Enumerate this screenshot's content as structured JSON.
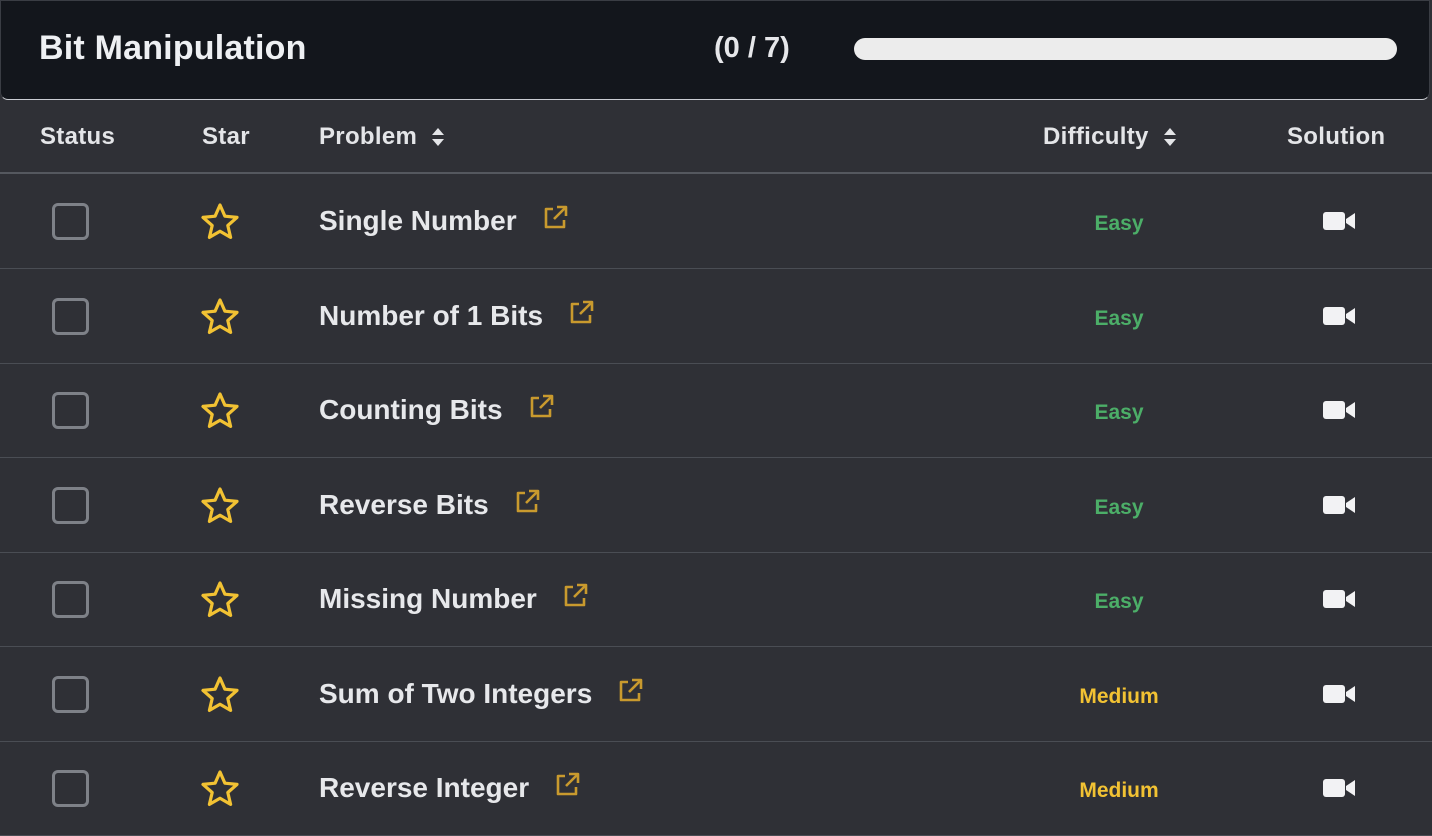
{
  "header": {
    "title": "Bit Manipulation",
    "progress_text": "(0 / 7)",
    "progress_fraction": 0
  },
  "table": {
    "columns": [
      "Status",
      "Star",
      "Problem",
      "Difficulty",
      "Solution"
    ],
    "rows": [
      {
        "problem": "Single Number",
        "difficulty": "Easy"
      },
      {
        "problem": "Number of 1 Bits",
        "difficulty": "Easy"
      },
      {
        "problem": "Counting Bits",
        "difficulty": "Easy"
      },
      {
        "problem": "Reverse Bits",
        "difficulty": "Easy"
      },
      {
        "problem": "Missing Number",
        "difficulty": "Easy"
      },
      {
        "problem": "Sum of Two Integers",
        "difficulty": "Medium"
      },
      {
        "problem": "Reverse Integer",
        "difficulty": "Medium"
      }
    ]
  },
  "colors": {
    "easy": "#4cae68",
    "medium": "#f2c233",
    "star": "#f2c233",
    "link_icon": "#c99a2e",
    "background": "#2f3036",
    "header_background": "#13161c"
  },
  "icons": {
    "status": "checkbox-icon",
    "star": "star-icon",
    "link": "external-link-icon",
    "solution": "video-camera-icon",
    "sort": "sort-icon"
  }
}
